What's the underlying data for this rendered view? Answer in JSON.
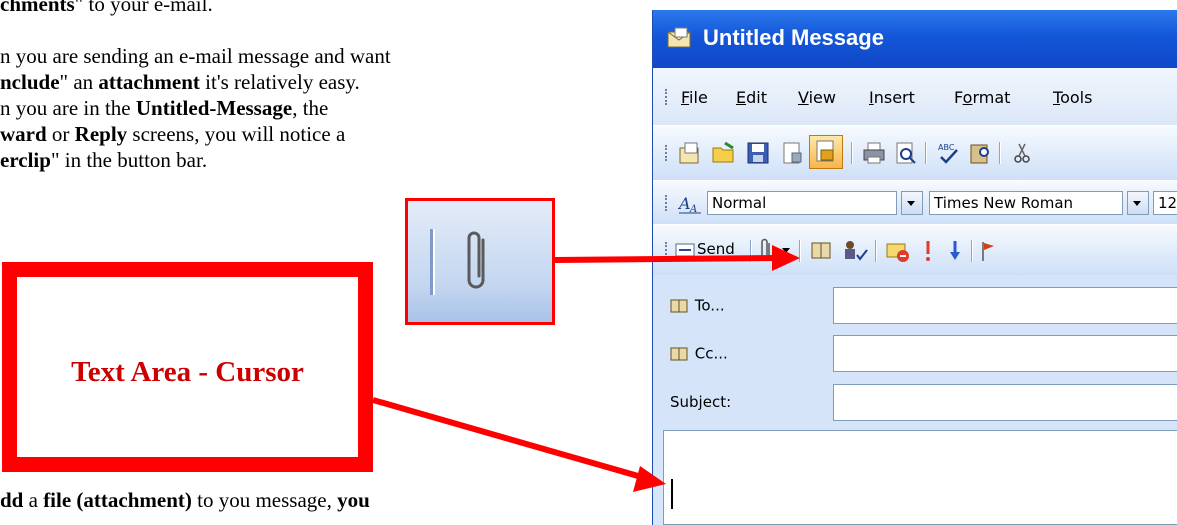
{
  "document": {
    "lines": [
      [
        {
          "t": "chments",
          "b": true
        },
        {
          "t": "\" to your e-mail.",
          "b": false
        }
      ],
      [
        {
          "t": "n you are sending an e-mail message and want",
          "b": false
        }
      ],
      [
        {
          "t": "nclude",
          "b": true
        },
        {
          "t": "\" an ",
          "b": false
        },
        {
          "t": "attachment",
          "b": true
        },
        {
          "t": " it's relatively easy.",
          "b": false
        }
      ],
      [
        {
          "t": "n you are in the ",
          "b": false
        },
        {
          "t": "Untitled-Message",
          "b": true
        },
        {
          "t": ", the",
          "b": false
        }
      ],
      [
        {
          "t": "ward",
          "b": true
        },
        {
          "t": " or ",
          "b": false
        },
        {
          "t": "Reply",
          "b": true
        },
        {
          "t": " screens, you will notice a",
          "b": false
        }
      ],
      [
        {
          "t": "erclip",
          "b": true
        },
        {
          "t": "\" in the button bar.",
          "b": false
        }
      ],
      [
        {
          "t": "dd",
          "b": true
        },
        {
          "t": " a ",
          "b": false
        },
        {
          "t": "file (attachment)",
          "b": true
        },
        {
          "t": " to you message, ",
          "b": false
        },
        {
          "t": "you",
          "b": true
        }
      ]
    ]
  },
  "callout": {
    "text": "Text Area - Cursor"
  },
  "window": {
    "title": "Untitled Message",
    "menu": [
      {
        "pre": "",
        "ul": "F",
        "post": "ile"
      },
      {
        "pre": "",
        "ul": "E",
        "post": "dit"
      },
      {
        "pre": "",
        "ul": "V",
        "post": "iew"
      },
      {
        "pre": "",
        "ul": "I",
        "post": "nsert"
      },
      {
        "pre": "F",
        "ul": "o",
        "post": "rmat"
      },
      {
        "pre": "",
        "ul": "T",
        "post": "ools"
      }
    ],
    "format_toolbar": {
      "style_value": "Normal",
      "font_value": "Times New Roman",
      "size_value": "12"
    },
    "send_label": "Send",
    "fields": {
      "to_label": "To...",
      "cc_label": "Cc...",
      "subject_label": "Subject:"
    }
  }
}
